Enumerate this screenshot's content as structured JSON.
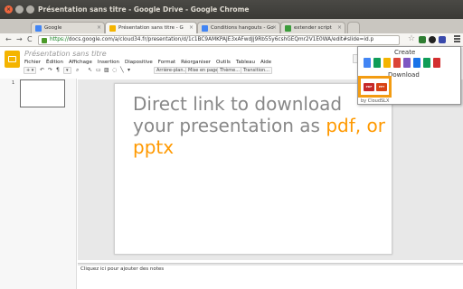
{
  "window": {
    "title": "Présentation sans titre - Google Drive - Google Chrome"
  },
  "tabs": [
    {
      "label": "Google",
      "icon": "google-favicon",
      "color": "#4285f4",
      "active": false
    },
    {
      "label": "Présentation sans titre - G",
      "icon": "slides-favicon",
      "color": "#f4b400",
      "active": true
    },
    {
      "label": "Conditions hangouts - Go",
      "icon": "drive-favicon",
      "color": "#4285f4",
      "active": false
    },
    {
      "label": "extender script",
      "icon": "script-favicon",
      "color": "#3b9c3b",
      "active": false
    }
  ],
  "omnibar": {
    "scheme": "https://",
    "url": "docs.google.com/a/cloud34.fr/presentation/d/1c1BC9AMKPAJE3xAFwdJj9Rb55y6cshGEQmr2V1E0WA/edit#slide=id.p"
  },
  "doc": {
    "title": "Présentation sans titre",
    "menu": [
      "Fichier",
      "Édition",
      "Affichage",
      "Insertion",
      "Diapositive",
      "Format",
      "Réorganiser",
      "Outils",
      "Tableau",
      "Aide"
    ],
    "toolbar": {
      "arriere_plan": "Arrière-plan...",
      "mise_en_page": "Mise en page ▾",
      "theme": "Thème...",
      "transition": "Transition..."
    },
    "slide_number": "1",
    "notes_placeholder": "Cliquez ici pour ajouter des notes"
  },
  "slide": {
    "text_normal": "Direct link to download your presentation as ",
    "text_highlight": "pdf, or pptx",
    "highlight_color": "#ff9900"
  },
  "popup": {
    "create_label": "Create",
    "download_label": "Download",
    "by_label": "by CloudSLX",
    "create_icons": [
      {
        "name": "doc",
        "color": "#4285f4"
      },
      {
        "name": "sheet",
        "color": "#0f9d58"
      },
      {
        "name": "slides",
        "color": "#f4b400"
      },
      {
        "name": "drawing",
        "color": "#db4437"
      },
      {
        "name": "form",
        "color": "#7e57c2"
      },
      {
        "name": "folder",
        "color": "#1a73e8"
      },
      {
        "name": "table",
        "color": "#0f9d58"
      },
      {
        "name": "script",
        "color": "#d32f2f"
      }
    ],
    "download_icons": [
      {
        "name": "pdf",
        "label": "PDF"
      },
      {
        "name": "pptx",
        "label": "PPT"
      }
    ],
    "accent": "#f39c12"
  }
}
